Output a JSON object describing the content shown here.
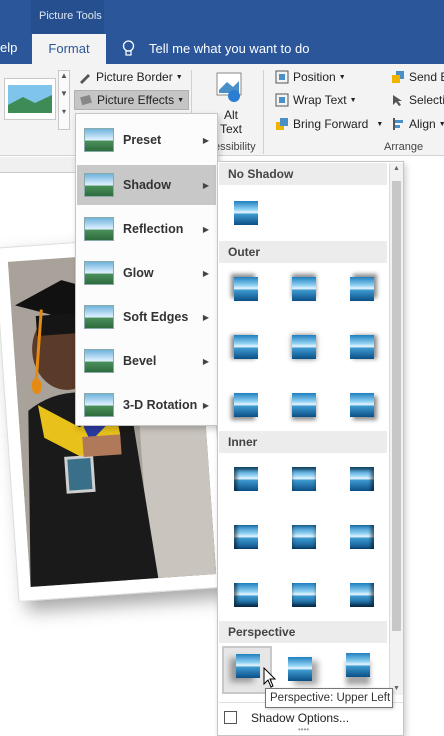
{
  "titlebar": {
    "context_label": "Picture Tools",
    "accent": "#2b579a"
  },
  "tabs": {
    "help_label": "elp",
    "format_label": "Format",
    "tell_me": "Tell me what you want to do"
  },
  "ribbon": {
    "picture_border": "Picture Border",
    "picture_effects": "Picture Effects",
    "alt_text_line1": "Alt",
    "alt_text_line2": "Text",
    "accessibility_label": "essibility",
    "position": "Position",
    "wrap_text": "Wrap Text",
    "bring_forward": "Bring Forward",
    "send_backward": "Send B",
    "selection_pane": "Selecti",
    "align": "Align",
    "arrange_label": "Arrange"
  },
  "submenu": {
    "items": [
      {
        "label": "Preset",
        "icon": "preset-icon"
      },
      {
        "label": "Shadow",
        "icon": "shadow-icon",
        "highlighted": true
      },
      {
        "label": "Reflection",
        "icon": "reflection-icon"
      },
      {
        "label": "Glow",
        "icon": "glow-icon"
      },
      {
        "label": "Soft Edges",
        "icon": "soft-edges-icon"
      },
      {
        "label": "Bevel",
        "icon": "bevel-icon"
      },
      {
        "label": "3-D Rotation",
        "icon": "3d-rotation-icon"
      }
    ]
  },
  "gallery": {
    "sections": {
      "no_shadow": "No Shadow",
      "outer": "Outer",
      "inner": "Inner",
      "perspective": "Perspective"
    },
    "footer_label": "Shadow Options..."
  },
  "tooltip": {
    "text": "Perspective: Upper Left"
  }
}
